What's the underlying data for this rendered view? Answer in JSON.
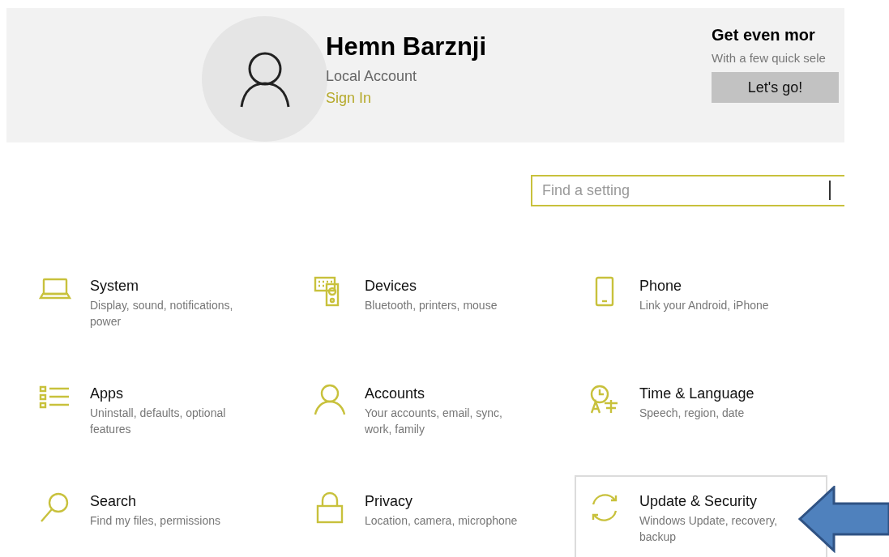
{
  "account": {
    "name": "Hemn Barznji",
    "type": "Local Account",
    "sign_in": "Sign In"
  },
  "promo": {
    "title": "Get even mor",
    "text": "With a few quick sele",
    "button": "Let's go!"
  },
  "search": {
    "placeholder": "Find a setting"
  },
  "tiles": [
    {
      "title": "System",
      "description": "Display, sound, notifications, power",
      "selected": false
    },
    {
      "title": "Devices",
      "description": "Bluetooth, printers, mouse",
      "selected": false
    },
    {
      "title": "Phone",
      "description": "Link your Android, iPhone",
      "selected": false
    },
    {
      "title": "Apps",
      "description": "Uninstall, defaults, optional features",
      "selected": false
    },
    {
      "title": "Accounts",
      "description": "Your accounts, email, sync, work, family",
      "selected": false
    },
    {
      "title": "Time & Language",
      "description": "Speech, region, date",
      "selected": false
    },
    {
      "title": "Search",
      "description": "Find my files, permissions",
      "selected": false
    },
    {
      "title": "Privacy",
      "description": "Location, camera, microphone",
      "selected": false
    },
    {
      "title": "Update & Security",
      "description": "Windows Update, recovery, backup",
      "selected": true
    }
  ]
}
